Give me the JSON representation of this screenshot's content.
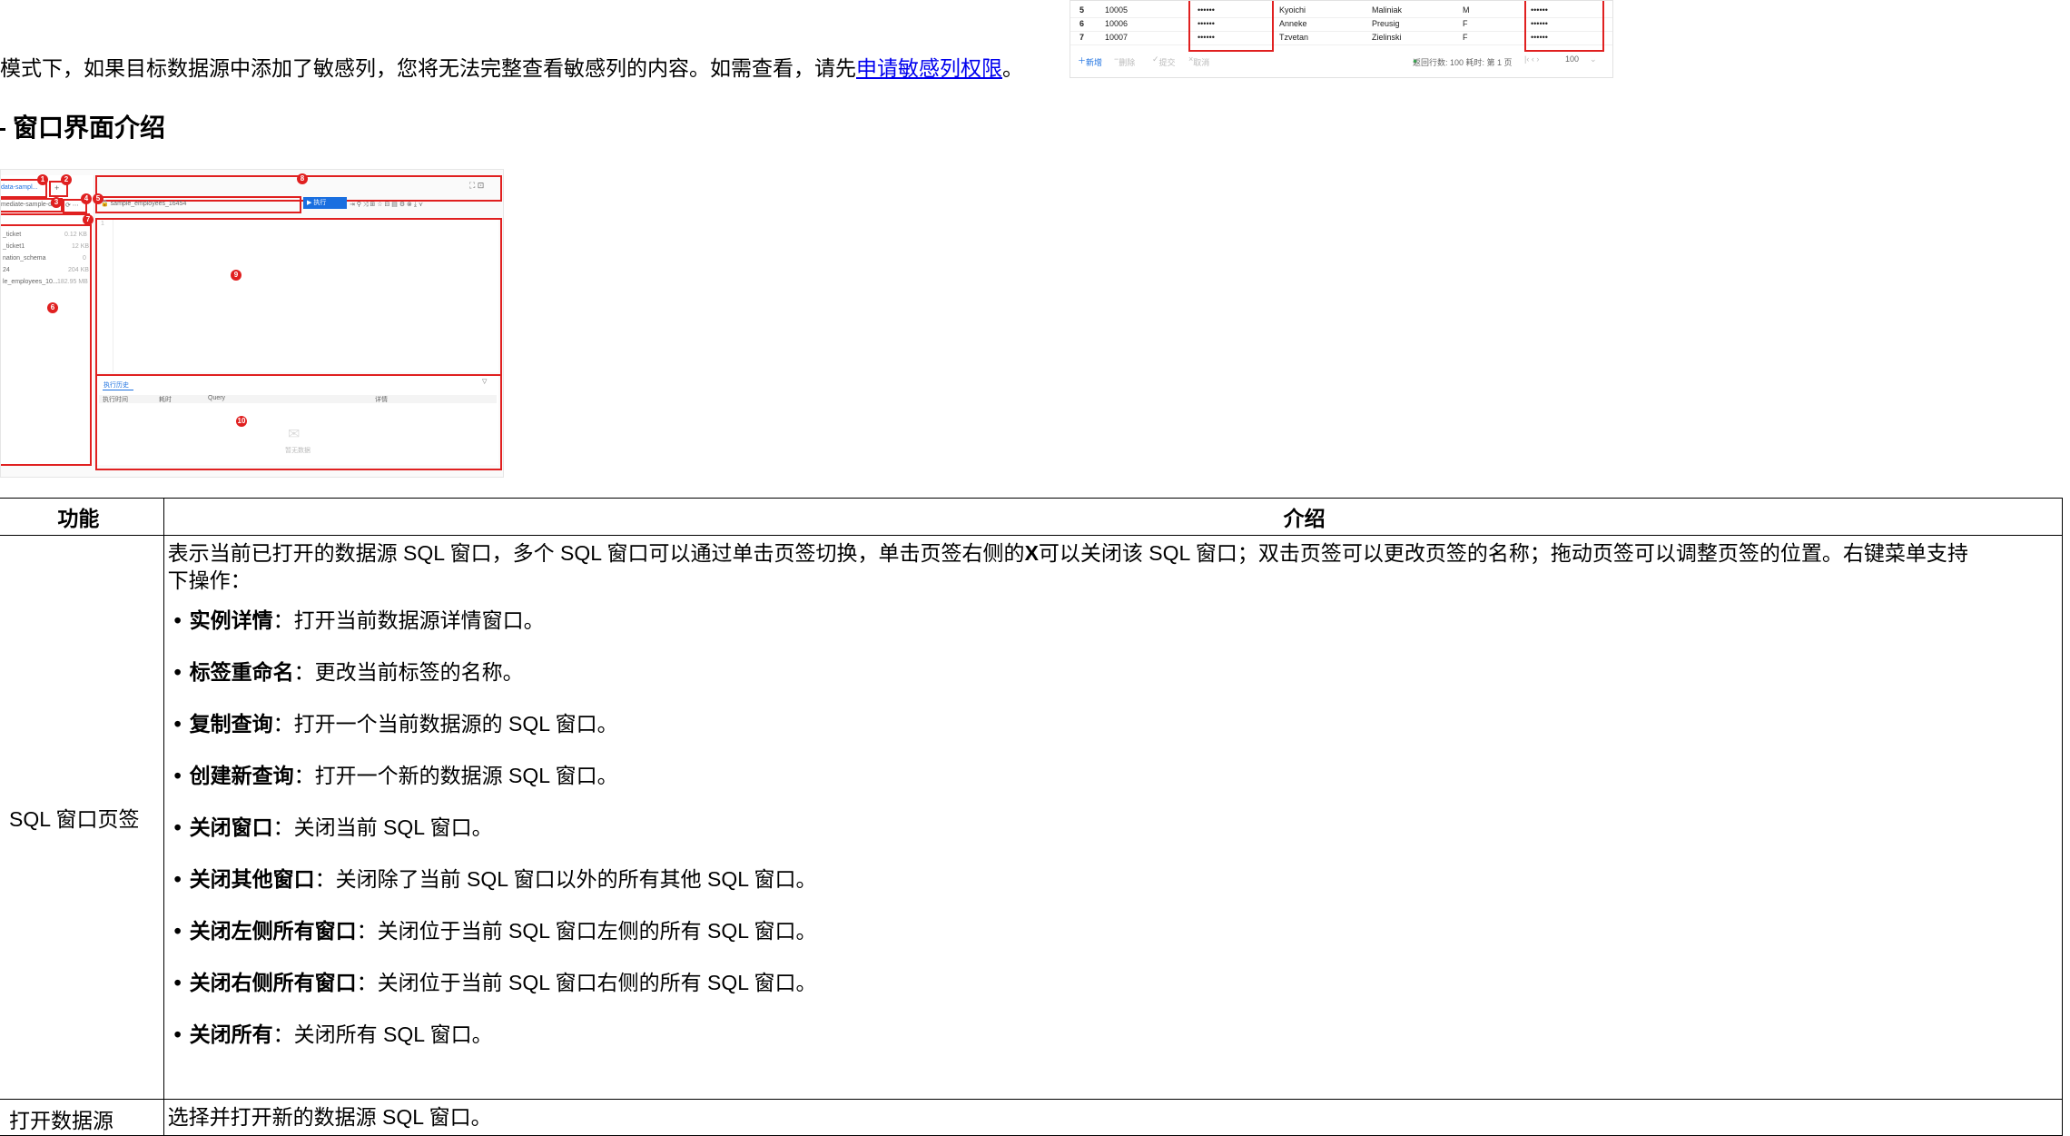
{
  "intro": {
    "text": "模式下，如果目标数据源中添加了敏感列，您将无法完整查看敏感列的内容。如需查看，请先",
    "link": "申请敏感列权限",
    "end": "。"
  },
  "top_grid": {
    "rows": [
      {
        "n": "5",
        "id": "10005",
        "mask": "••••••",
        "first": "Kyoichi",
        "last": "Maliniak",
        "g": "M",
        "mask2": "••••••"
      },
      {
        "n": "6",
        "id": "10006",
        "mask": "••••••",
        "first": "Anneke",
        "last": "Preusig",
        "g": "F",
        "mask2": "••••••"
      },
      {
        "n": "7",
        "id": "10007",
        "mask": "••••••",
        "first": "Tzvetan",
        "last": "Zielinski",
        "g": "F",
        "mask2": "••••••"
      }
    ],
    "footer": {
      "add": "新增",
      "delete": "删除",
      "submit": "提交",
      "cancel": "取消",
      "stats": "返回行数: 100  耗时:  第 1 页",
      "page_size": "100"
    }
  },
  "heading": "窗口界面介绍",
  "screenshot": {
    "tab": "data-sampl...",
    "add": "+",
    "search": "mediate-sample-da",
    "editor_tab": "sample_employees_16454",
    "run": "执行",
    "tree": [
      {
        "name": "_ticket",
        "size": "0.12 KB"
      },
      {
        "name": "_ticket1",
        "size": "12 KB"
      },
      {
        "name": "nation_schema",
        "size": "0"
      },
      {
        "name": "24",
        "size": "204 KB"
      },
      {
        "name": "le_employees_10...",
        "size": "182.95 MB"
      }
    ],
    "history_tab": "执行历史",
    "history_cols": [
      "执行时间",
      "耗时",
      "Query",
      "详情"
    ],
    "empty": "暂无数据",
    "markers": [
      "1",
      "2",
      "3",
      "4",
      "5",
      "6",
      "7",
      "8",
      "9",
      "10"
    ]
  },
  "table": {
    "headers": [
      "功能",
      "介绍"
    ],
    "row1": {
      "function": "SQL 窗口页签",
      "intro_a": "表示当前已打开的数据源 SQL 窗口，多个 SQL 窗口可以通过单击页签切换，单击页签右侧的",
      "intro_x": "X",
      "intro_b": "可以关闭该 SQL 窗口；双击页签可以更改页签的名称；拖动页签可以调整页签的位置。右键菜单支持",
      "intro_c": "下操作：",
      "items": [
        {
          "bold": "实例详情",
          "text": "：打开当前数据源详情窗口。"
        },
        {
          "bold": "标签重命名",
          "text": "：更改当前标签的名称。"
        },
        {
          "bold": "复制查询",
          "text": "：打开一个当前数据源的 SQL 窗口。"
        },
        {
          "bold": "创建新查询",
          "text": "：打开一个新的数据源 SQL 窗口。"
        },
        {
          "bold": "关闭窗口",
          "text": "：关闭当前 SQL 窗口。"
        },
        {
          "bold": "关闭其他窗口",
          "text": "：关闭除了当前 SQL 窗口以外的所有其他 SQL 窗口。"
        },
        {
          "bold": "关闭左侧所有窗口",
          "text": "：关闭位于当前 SQL 窗口左侧的所有 SQL 窗口。"
        },
        {
          "bold": "关闭右侧所有窗口",
          "text": "：关闭位于当前 SQL 窗口右侧的所有 SQL 窗口。"
        },
        {
          "bold": "关闭所有",
          "text": "：关闭所有 SQL 窗口。"
        }
      ]
    },
    "row2": {
      "function": "打开数据源",
      "intro": "选择并打开新的数据源 SQL 窗口。"
    }
  }
}
